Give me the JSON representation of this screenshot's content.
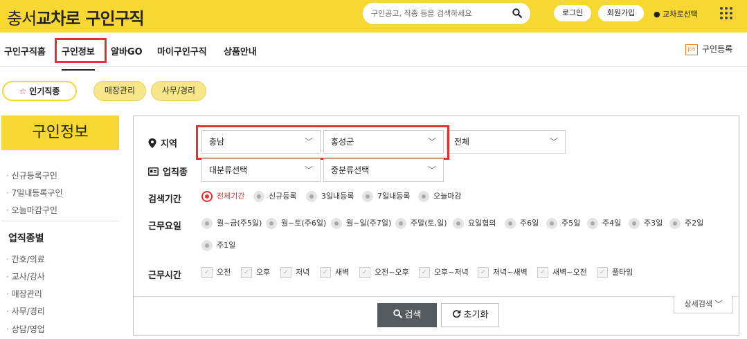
{
  "header": {
    "logo_pre": "충서",
    "logo_mid": "교차로",
    "logo_post": "구인구직",
    "search_placeholder": "구인공고, 직종 등을 검색하세요",
    "login": "로그인",
    "join": "회원가입",
    "region_select": "교차로선택",
    "brand_color": "#f7d832"
  },
  "nav": {
    "items": [
      "구인구직홈",
      "구인정보",
      "알바GO",
      "마이구인구직",
      "상품안내"
    ],
    "active": "구인정보",
    "register": "구인등록",
    "register_icon_text": "JOB"
  },
  "chips": {
    "popular": "인기직종",
    "items": [
      "매장관리",
      "사무/경리"
    ]
  },
  "sidebar": {
    "title": "구인정보",
    "links": [
      "신규등록구인",
      "7일내등록구인",
      "오늘마감구인"
    ],
    "category_title": "업직종별",
    "categories": [
      "간호/의료",
      "교사/강사",
      "매장관리",
      "사무/경리",
      "상담/영업"
    ]
  },
  "filters": {
    "region_label": "지역",
    "region_values": [
      "충남",
      "홍성군",
      "전체"
    ],
    "job_label": "업직종",
    "job_values": [
      "대분류선택",
      "중분류선택"
    ],
    "period_label": "검색기간",
    "period_options": [
      "전체기간",
      "신규등록",
      "3일내등록",
      "7일내등록",
      "오늘마감"
    ],
    "period_selected": "전체기간",
    "workday_label": "근무요일",
    "workday_options": [
      "월~금(주5일)",
      "월~토(주6일)",
      "월~일(주7일)",
      "주말(토,일)",
      "요일협의",
      "주6일",
      "주5일",
      "주4일",
      "주3일",
      "주2일",
      "주1일"
    ],
    "worktime_label": "근무시간",
    "worktime_options": [
      "오전",
      "오후",
      "저녁",
      "새벽",
      "오전~오후",
      "오후~저녁",
      "저녁~새벽",
      "새벽~오전",
      "풀타임"
    ],
    "detail_search": "상세검색",
    "search_button": "검색",
    "reset_button": "초기화",
    "highlight_color": "#e53030"
  }
}
